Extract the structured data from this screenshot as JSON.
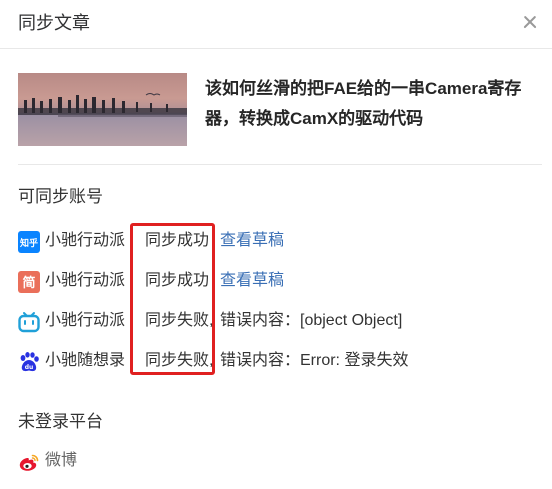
{
  "dialog": {
    "title": "同步文章"
  },
  "article": {
    "title": "该如何丝滑的把FAE给的一串Camera寄存器，转换成CamX的驱动代码"
  },
  "synced_accounts": {
    "label": "可同步账号",
    "items": [
      {
        "platform_icon": "zhihu-icon",
        "icon_text": "知乎",
        "account": "小驰行动派",
        "status": "同步成功",
        "link": "查看草稿",
        "error": ""
      },
      {
        "platform_icon": "jianshu-icon",
        "icon_text": "简",
        "account": "小驰行动派",
        "status": "同步成功",
        "link": "查看草稿",
        "error": ""
      },
      {
        "platform_icon": "bilibili-icon",
        "icon_text": "",
        "account": "小驰行动派",
        "status": "同步失败,",
        "link": "",
        "error": "错误内容：[object Object]"
      },
      {
        "platform_icon": "baidu-icon",
        "icon_text": "du",
        "account": "小驰随想录",
        "status": "同步失败,",
        "link": "",
        "error": "错误内容：Error: 登录失效"
      }
    ]
  },
  "unlogged": {
    "label": "未登录平台",
    "items": [
      {
        "platform_icon": "weibo-icon",
        "name": "微博"
      }
    ]
  },
  "colors": {
    "link": "#3a6fb5",
    "highlight": "#e02020",
    "zhihu": "#0a84ff",
    "jianshu": "#ea6f5a",
    "bilibili": "#20a0d8",
    "baidu": "#2932e1",
    "weibo": "#e6162d"
  }
}
